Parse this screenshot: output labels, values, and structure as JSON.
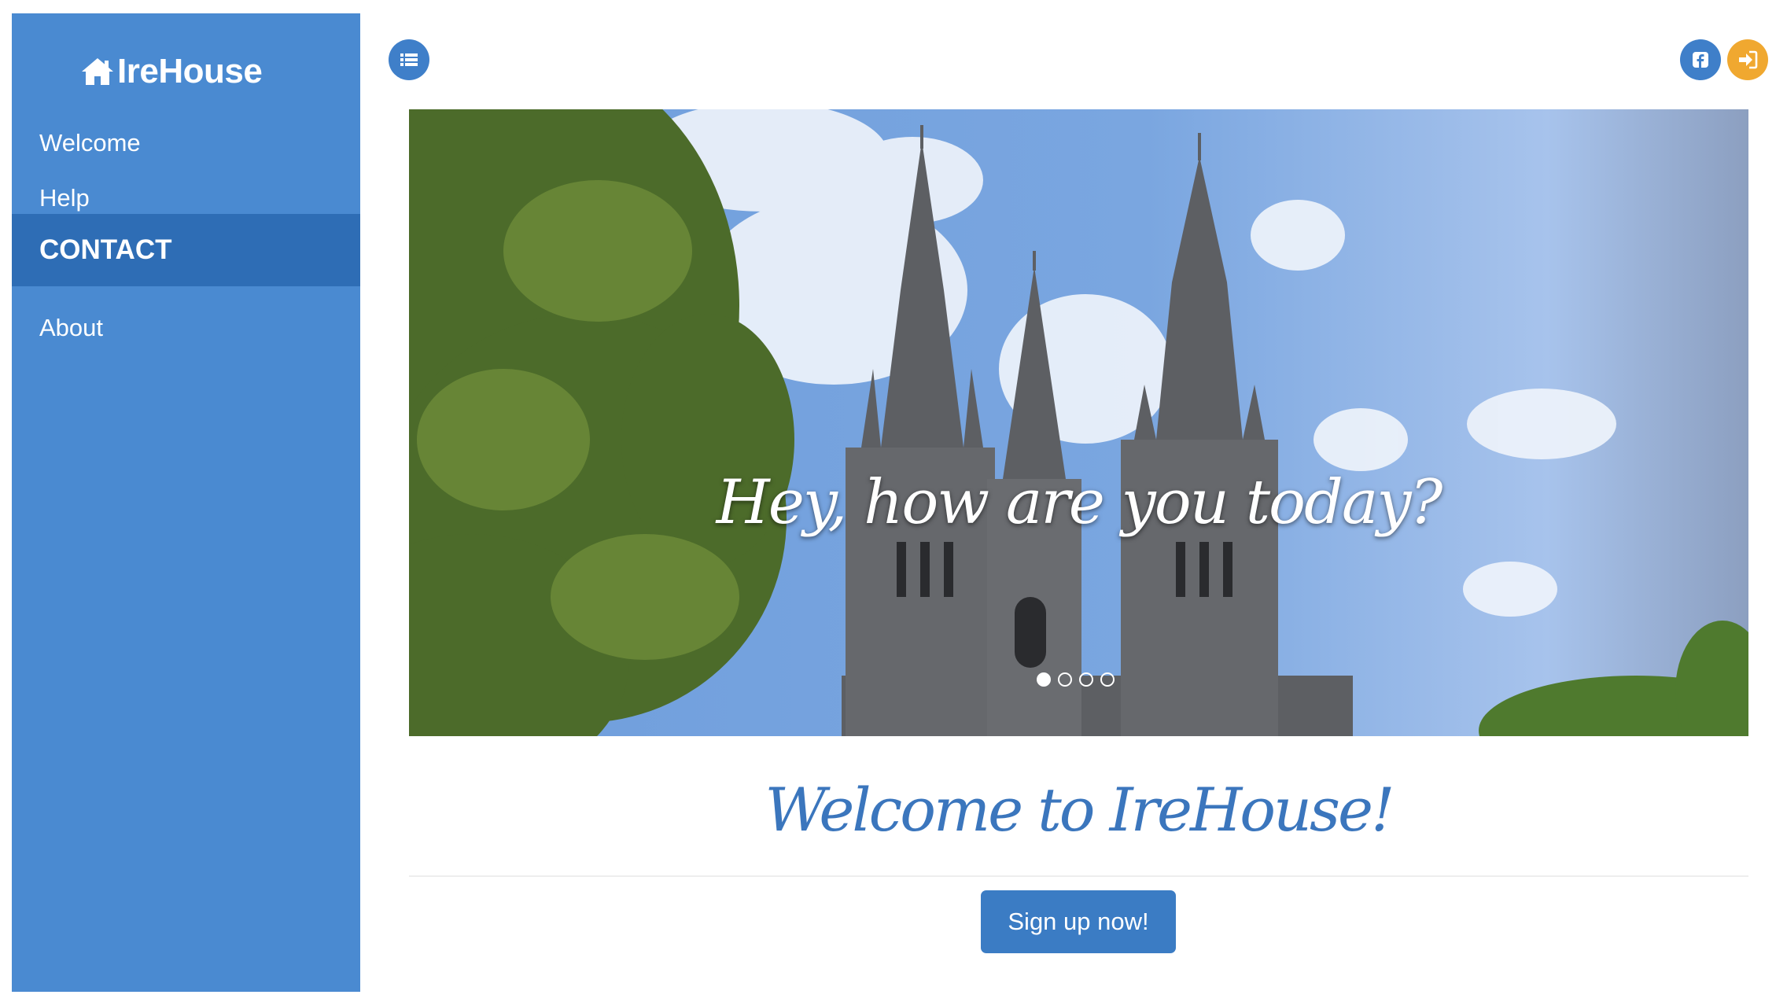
{
  "brand": {
    "name": "IreHouse",
    "icon": "home-icon"
  },
  "sidebar": {
    "items": [
      {
        "label": "Welcome",
        "active": false
      },
      {
        "label": "Help",
        "active": false
      },
      {
        "label": "CONTACT",
        "active": true
      },
      {
        "label": "About",
        "active": false
      }
    ]
  },
  "toolbar": {
    "menu_icon": "list-icon",
    "facebook_icon": "facebook-icon",
    "login_icon": "sign-in-icon"
  },
  "carousel": {
    "caption": "Hey, how are you today?",
    "slide_count": 4,
    "active_slide": 1
  },
  "main": {
    "heading": "Welcome to IreHouse!",
    "signup_label": "Sign up now!"
  },
  "colors": {
    "sidebar": "#4a8ad1",
    "sidebar_active": "#2e6db5",
    "primary": "#3b7cc4",
    "login_button": "#f0a830",
    "heading": "#3b76bd"
  }
}
